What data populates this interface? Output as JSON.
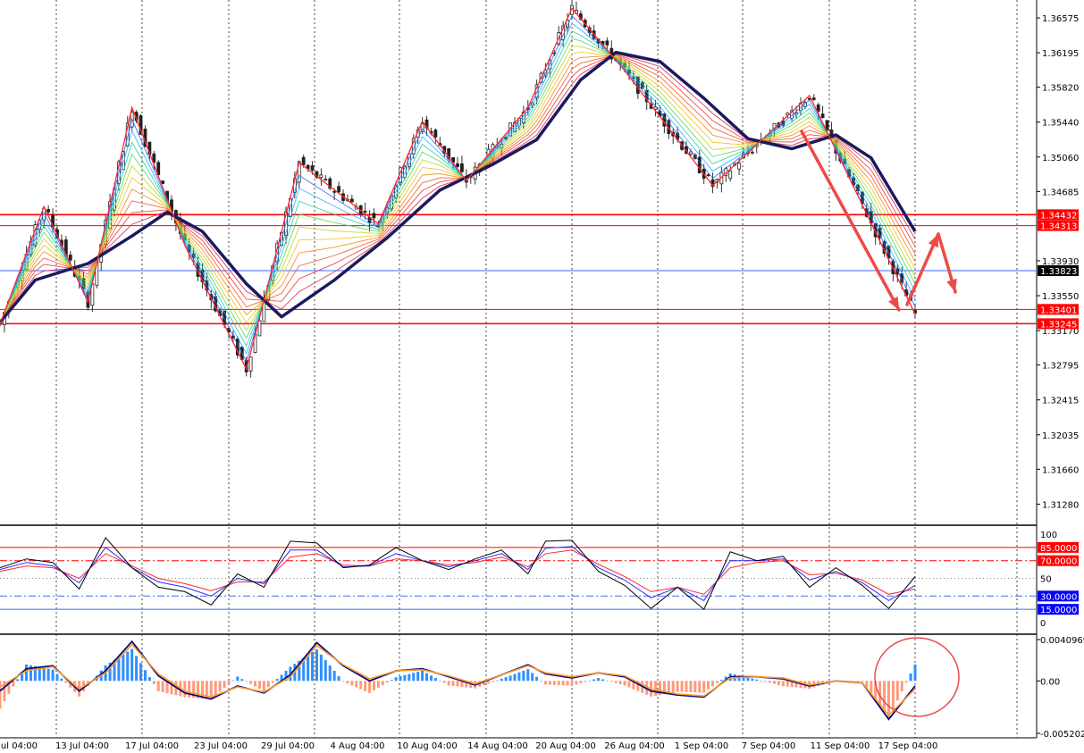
{
  "colors": {
    "background": "#ffffff",
    "grid": "#444444",
    "bull_candle": "#3a3a3a",
    "bear_candle": "#2a2a2a",
    "zigzag": "#ff2a2a",
    "slow_ma": "#1a1a5e",
    "level_red": "#ff0000",
    "level_blue": "#3a6bff",
    "stoch_main": "#000000",
    "stoch_blue": "#2a2aff",
    "stoch_red": "#ff2a2a",
    "macd_pos": "#2f8fff",
    "macd_neg": "#ff9a7a",
    "macd_line": "#0a0a7a",
    "macd_signal": "#ff9a2a",
    "price_box_red": "#ff0000",
    "price_box_black": "#000000",
    "price_box_blue": "#0000ff",
    "circle": "#e84a4a",
    "arrow": "#f04848"
  },
  "price_axis": {
    "ticks": [
      "1.36575",
      "1.36195",
      "1.35820",
      "1.35440",
      "1.35060",
      "1.34685",
      "1.33930",
      "1.33550",
      "1.33170",
      "1.32795",
      "1.32415",
      "1.32035",
      "1.31660",
      "1.31280"
    ],
    "level_labels": [
      {
        "text": "1.34432",
        "style": "red"
      },
      {
        "text": "1.34313",
        "style": "red"
      },
      {
        "text": "1.33823",
        "style": "black"
      },
      {
        "text": "1.33401",
        "style": "red"
      },
      {
        "text": "1.33245",
        "style": "red"
      }
    ]
  },
  "stoch_axis": {
    "ticks": [
      "100",
      "50",
      "0"
    ],
    "level_labels": [
      {
        "text": "85.0000",
        "style": "red"
      },
      {
        "text": "70.0000",
        "style": "red"
      },
      {
        "text": "30.0000",
        "style": "blue"
      },
      {
        "text": "15.0000",
        "style": "blue"
      }
    ]
  },
  "macd_axis": {
    "ticks": [
      "0.0040969",
      "0.00",
      "-0.005202"
    ]
  },
  "time_axis": {
    "labels": [
      "Jul 04:00",
      "13 Jul 04:00",
      "17 Jul 04:00",
      "23 Jul 04:00",
      "29 Jul 04:00",
      "4 Aug 04:00",
      "10 Aug 04:00",
      "14 Aug 04:00",
      "20 Aug 04:00",
      "26 Aug 04:00",
      "1 Sep 04:00",
      "7 Sep 04:00",
      "11 Sep 04:00",
      "17 Sep 04:00"
    ]
  },
  "chart_data": {
    "type": "line",
    "ylim": [
      1.3106,
      1.3677
    ],
    "zigzag": [
      {
        "t": 0,
        "p": 1.3324
      },
      {
        "t": 5,
        "p": 1.3452
      },
      {
        "t": 10,
        "p": 1.3348
      },
      {
        "t": 15,
        "p": 1.356
      },
      {
        "t": 21,
        "p": 1.341
      },
      {
        "t": 28,
        "p": 1.3275
      },
      {
        "t": 34,
        "p": 1.35
      },
      {
        "t": 43,
        "p": 1.3433
      },
      {
        "t": 48,
        "p": 1.3545
      },
      {
        "t": 53,
        "p": 1.348
      },
      {
        "t": 60,
        "p": 1.356
      },
      {
        "t": 65,
        "p": 1.3668
      },
      {
        "t": 71,
        "p": 1.36
      },
      {
        "t": 81,
        "p": 1.3475
      },
      {
        "t": 92,
        "p": 1.3573
      },
      {
        "t": 104,
        "p": 1.3335
      }
    ],
    "slow_ma": [
      {
        "t": 0,
        "p": 1.3326
      },
      {
        "t": 4,
        "p": 1.3372
      },
      {
        "t": 10,
        "p": 1.339
      },
      {
        "t": 15,
        "p": 1.342
      },
      {
        "t": 19,
        "p": 1.3446
      },
      {
        "t": 23,
        "p": 1.3425
      },
      {
        "t": 28,
        "p": 1.3368
      },
      {
        "t": 32,
        "p": 1.3332
      },
      {
        "t": 38,
        "p": 1.3372
      },
      {
        "t": 44,
        "p": 1.3418
      },
      {
        "t": 50,
        "p": 1.347
      },
      {
        "t": 56,
        "p": 1.3498
      },
      {
        "t": 61,
        "p": 1.3525
      },
      {
        "t": 66,
        "p": 1.359
      },
      {
        "t": 70,
        "p": 1.362
      },
      {
        "t": 75,
        "p": 1.361
      },
      {
        "t": 80,
        "p": 1.357
      },
      {
        "t": 85,
        "p": 1.3526
      },
      {
        "t": 90,
        "p": 1.3515
      },
      {
        "t": 95,
        "p": 1.353
      },
      {
        "t": 99,
        "p": 1.3505
      },
      {
        "t": 104,
        "p": 1.3425
      }
    ],
    "levels": [
      {
        "p": 1.34432,
        "style": "red"
      },
      {
        "p": 1.34313,
        "style": "red"
      },
      {
        "p": 1.33823,
        "style": "blue"
      },
      {
        "p": 1.33401,
        "style": "red"
      },
      {
        "p": 1.33245,
        "style": "red"
      }
    ],
    "stochastic": {
      "ylim": [
        0,
        100
      ],
      "levels": [
        85,
        70,
        30,
        15
      ],
      "main": [
        {
          "t": 0,
          "v": 62
        },
        {
          "t": 3,
          "v": 72
        },
        {
          "t": 6,
          "v": 68
        },
        {
          "t": 9,
          "v": 38
        },
        {
          "t": 12,
          "v": 96
        },
        {
          "t": 15,
          "v": 62
        },
        {
          "t": 18,
          "v": 40
        },
        {
          "t": 21,
          "v": 35
        },
        {
          "t": 24,
          "v": 20
        },
        {
          "t": 27,
          "v": 55
        },
        {
          "t": 30,
          "v": 40
        },
        {
          "t": 33,
          "v": 92
        },
        {
          "t": 36,
          "v": 90
        },
        {
          "t": 39,
          "v": 62
        },
        {
          "t": 42,
          "v": 65
        },
        {
          "t": 45,
          "v": 85
        },
        {
          "t": 48,
          "v": 70
        },
        {
          "t": 51,
          "v": 60
        },
        {
          "t": 54,
          "v": 72
        },
        {
          "t": 57,
          "v": 82
        },
        {
          "t": 60,
          "v": 55
        },
        {
          "t": 62,
          "v": 92
        },
        {
          "t": 65,
          "v": 93
        },
        {
          "t": 68,
          "v": 58
        },
        {
          "t": 71,
          "v": 42
        },
        {
          "t": 74,
          "v": 16
        },
        {
          "t": 77,
          "v": 40
        },
        {
          "t": 80,
          "v": 15
        },
        {
          "t": 83,
          "v": 80
        },
        {
          "t": 86,
          "v": 70
        },
        {
          "t": 89,
          "v": 75
        },
        {
          "t": 92,
          "v": 40
        },
        {
          "t": 95,
          "v": 62
        },
        {
          "t": 98,
          "v": 42
        },
        {
          "t": 101,
          "v": 16
        },
        {
          "t": 104,
          "v": 52
        }
      ],
      "blue": [
        {
          "t": 0,
          "v": 60
        },
        {
          "t": 3,
          "v": 68
        },
        {
          "t": 6,
          "v": 64
        },
        {
          "t": 9,
          "v": 45
        },
        {
          "t": 12,
          "v": 85
        },
        {
          "t": 15,
          "v": 62
        },
        {
          "t": 18,
          "v": 46
        },
        {
          "t": 21,
          "v": 40
        },
        {
          "t": 24,
          "v": 30
        },
        {
          "t": 27,
          "v": 50
        },
        {
          "t": 30,
          "v": 44
        },
        {
          "t": 33,
          "v": 82
        },
        {
          "t": 36,
          "v": 82
        },
        {
          "t": 39,
          "v": 63
        },
        {
          "t": 42,
          "v": 64
        },
        {
          "t": 45,
          "v": 78
        },
        {
          "t": 48,
          "v": 70
        },
        {
          "t": 51,
          "v": 63
        },
        {
          "t": 54,
          "v": 70
        },
        {
          "t": 57,
          "v": 78
        },
        {
          "t": 60,
          "v": 60
        },
        {
          "t": 62,
          "v": 84
        },
        {
          "t": 65,
          "v": 86
        },
        {
          "t": 68,
          "v": 62
        },
        {
          "t": 71,
          "v": 48
        },
        {
          "t": 74,
          "v": 28
        },
        {
          "t": 77,
          "v": 40
        },
        {
          "t": 80,
          "v": 25
        },
        {
          "t": 83,
          "v": 70
        },
        {
          "t": 86,
          "v": 70
        },
        {
          "t": 89,
          "v": 72
        },
        {
          "t": 92,
          "v": 48
        },
        {
          "t": 95,
          "v": 58
        },
        {
          "t": 98,
          "v": 45
        },
        {
          "t": 101,
          "v": 25
        },
        {
          "t": 104,
          "v": 42
        }
      ],
      "red": [
        {
          "t": 0,
          "v": 58
        },
        {
          "t": 3,
          "v": 64
        },
        {
          "t": 6,
          "v": 62
        },
        {
          "t": 9,
          "v": 50
        },
        {
          "t": 12,
          "v": 78
        },
        {
          "t": 15,
          "v": 64
        },
        {
          "t": 18,
          "v": 50
        },
        {
          "t": 21,
          "v": 44
        },
        {
          "t": 24,
          "v": 36
        },
        {
          "t": 27,
          "v": 46
        },
        {
          "t": 30,
          "v": 46
        },
        {
          "t": 33,
          "v": 74
        },
        {
          "t": 36,
          "v": 78
        },
        {
          "t": 39,
          "v": 65
        },
        {
          "t": 42,
          "v": 64
        },
        {
          "t": 45,
          "v": 72
        },
        {
          "t": 48,
          "v": 70
        },
        {
          "t": 51,
          "v": 65
        },
        {
          "t": 54,
          "v": 68
        },
        {
          "t": 57,
          "v": 74
        },
        {
          "t": 60,
          "v": 63
        },
        {
          "t": 62,
          "v": 78
        },
        {
          "t": 65,
          "v": 82
        },
        {
          "t": 68,
          "v": 66
        },
        {
          "t": 71,
          "v": 52
        },
        {
          "t": 74,
          "v": 35
        },
        {
          "t": 77,
          "v": 40
        },
        {
          "t": 80,
          "v": 32
        },
        {
          "t": 83,
          "v": 62
        },
        {
          "t": 86,
          "v": 68
        },
        {
          "t": 89,
          "v": 70
        },
        {
          "t": 92,
          "v": 54
        },
        {
          "t": 95,
          "v": 56
        },
        {
          "t": 98,
          "v": 48
        },
        {
          "t": 101,
          "v": 32
        },
        {
          "t": 104,
          "v": 38
        }
      ]
    },
    "macd": {
      "ylim": [
        -0.005202,
        0.0040969
      ],
      "line": [
        {
          "t": 0,
          "v": -0.001
        },
        {
          "t": 3,
          "v": 0.0012
        },
        {
          "t": 6,
          "v": 0.0015
        },
        {
          "t": 9,
          "v": -0.001
        },
        {
          "t": 12,
          "v": 0.001
        },
        {
          "t": 15,
          "v": 0.0039
        },
        {
          "t": 18,
          "v": 0.0005
        },
        {
          "t": 21,
          "v": -0.0012
        },
        {
          "t": 24,
          "v": -0.0018
        },
        {
          "t": 27,
          "v": -0.0005
        },
        {
          "t": 30,
          "v": -0.0012
        },
        {
          "t": 33,
          "v": 0.0006
        },
        {
          "t": 36,
          "v": 0.0038
        },
        {
          "t": 39,
          "v": 0.0015
        },
        {
          "t": 42,
          "v": 0.0
        },
        {
          "t": 45,
          "v": 0.001
        },
        {
          "t": 48,
          "v": 0.0012
        },
        {
          "t": 51,
          "v": 0.0004
        },
        {
          "t": 54,
          "v": -0.0004
        },
        {
          "t": 57,
          "v": 0.0006
        },
        {
          "t": 60,
          "v": 0.0016
        },
        {
          "t": 62,
          "v": 0.0007
        },
        {
          "t": 65,
          "v": 0.0003
        },
        {
          "t": 68,
          "v": 0.0008
        },
        {
          "t": 71,
          "v": 0.0004
        },
        {
          "t": 74,
          "v": -0.001
        },
        {
          "t": 77,
          "v": -0.0014
        },
        {
          "t": 80,
          "v": -0.0016
        },
        {
          "t": 83,
          "v": 0.0004
        },
        {
          "t": 86,
          "v": 0.0004
        },
        {
          "t": 89,
          "v": 0.0002
        },
        {
          "t": 92,
          "v": -0.0005
        },
        {
          "t": 95,
          "v": 0.0
        },
        {
          "t": 98,
          "v": -0.0002
        },
        {
          "t": 101,
          "v": -0.0038
        },
        {
          "t": 104,
          "v": -0.0005
        }
      ],
      "signal": [
        {
          "t": 0,
          "v": -0.0006
        },
        {
          "t": 3,
          "v": 0.001
        },
        {
          "t": 6,
          "v": 0.0014
        },
        {
          "t": 9,
          "v": -0.0008
        },
        {
          "t": 12,
          "v": 0.0008
        },
        {
          "t": 15,
          "v": 0.0036
        },
        {
          "t": 18,
          "v": 0.0007
        },
        {
          "t": 21,
          "v": -0.001
        },
        {
          "t": 24,
          "v": -0.0016
        },
        {
          "t": 27,
          "v": -0.0006
        },
        {
          "t": 30,
          "v": -0.0011
        },
        {
          "t": 33,
          "v": 0.0004
        },
        {
          "t": 36,
          "v": 0.0035
        },
        {
          "t": 39,
          "v": 0.0016
        },
        {
          "t": 42,
          "v": 0.0002
        },
        {
          "t": 45,
          "v": 0.001
        },
        {
          "t": 48,
          "v": 0.0011
        },
        {
          "t": 51,
          "v": 0.0005
        },
        {
          "t": 54,
          "v": -0.0003
        },
        {
          "t": 57,
          "v": 0.0006
        },
        {
          "t": 60,
          "v": 0.0015
        },
        {
          "t": 62,
          "v": 0.0008
        },
        {
          "t": 65,
          "v": 0.0004
        },
        {
          "t": 68,
          "v": 0.0008
        },
        {
          "t": 71,
          "v": 0.0005
        },
        {
          "t": 74,
          "v": -0.0008
        },
        {
          "t": 77,
          "v": -0.0013
        },
        {
          "t": 80,
          "v": -0.0015
        },
        {
          "t": 83,
          "v": 0.0003
        },
        {
          "t": 86,
          "v": 0.0004
        },
        {
          "t": 89,
          "v": 0.0003
        },
        {
          "t": 92,
          "v": -0.0004
        },
        {
          "t": 95,
          "v": 0.0
        },
        {
          "t": 98,
          "v": -0.0002
        },
        {
          "t": 101,
          "v": -0.0034
        },
        {
          "t": 104,
          "v": -0.0008
        }
      ]
    }
  }
}
